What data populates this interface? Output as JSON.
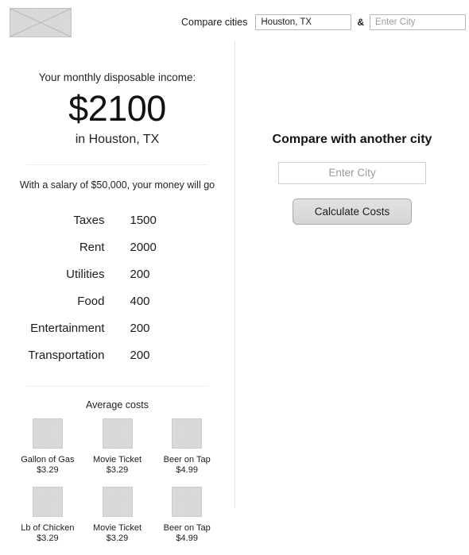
{
  "header": {
    "logo_alt": "site-logo-placeholder",
    "compare_label": "Compare cities",
    "city_one_value": "Houston, TX",
    "city_one_placeholder": "Enter City",
    "ampersand": "&",
    "city_two_value": "",
    "city_two_placeholder": "Enter City"
  },
  "summary": {
    "caption": "Your monthly disposable income:",
    "amount": "$2100",
    "city_line": "in Houston, TX",
    "salary_line": "With a salary of $50,000, your money will go"
  },
  "expenses": {
    "rows": [
      {
        "label": "Taxes",
        "value": "1500"
      },
      {
        "label": "Rent",
        "value": "2000"
      },
      {
        "label": "Utilities",
        "value": "200"
      },
      {
        "label": "Food",
        "value": "400"
      },
      {
        "label": "Entertainment",
        "value": "200"
      },
      {
        "label": "Transportation",
        "value": "200"
      }
    ]
  },
  "average_costs": {
    "title": "Average costs",
    "rows": [
      [
        {
          "name": "Gallon of Gas",
          "price": "$3.29"
        },
        {
          "name": "Movie Ticket",
          "price": "$3.29"
        },
        {
          "name": "Beer on Tap",
          "price": "$4.99"
        }
      ],
      [
        {
          "name": "Lb of Chicken",
          "price": "$3.29"
        },
        {
          "name": "Movie Ticket",
          "price": "$3.29"
        },
        {
          "name": "Beer on Tap",
          "price": "$4.99"
        }
      ]
    ]
  },
  "compare_panel": {
    "title": "Compare with another city",
    "city_value": "",
    "city_placeholder": "Enter City",
    "button_label": "Calculate Costs"
  },
  "colors": {
    "page_background": "#ffffff",
    "text": "#1c1c1c",
    "placeholder_text": "#9a9a9a",
    "divider": "#e4e4e4",
    "placeholder_fill": "#d9d9d9",
    "button_fill": "#dcdcdc",
    "input_border": "#b9b9b9"
  }
}
